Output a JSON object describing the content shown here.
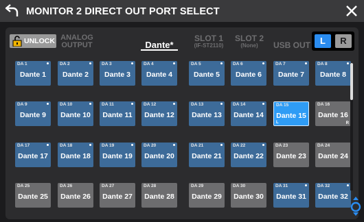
{
  "window": {
    "title": "MONITOR 2 DIRECT OUT PORT SELECT"
  },
  "toolbar": {
    "unlock_label": "UNLOCK",
    "tabs": [
      {
        "line1": "ANALOG",
        "line2": "OUTPUT"
      },
      {
        "line1": "Dante*",
        "line2": ""
      },
      {
        "line1": "SLOT 1",
        "line2": "(IF-ST2110)"
      },
      {
        "line1": "SLOT 2",
        "line2": "(None)"
      },
      {
        "line1": "USB OUT",
        "line2": ""
      }
    ],
    "active_tab": "Dante*",
    "channel_l": "L",
    "channel_r": "R"
  },
  "ports": [
    {
      "da": "DA 1",
      "name": "Dante 1",
      "state": "blue",
      "dot": true
    },
    {
      "da": "DA 2",
      "name": "Dante 2",
      "state": "blue",
      "dot": true
    },
    {
      "da": "DA 3",
      "name": "Dante 3",
      "state": "blue",
      "dot": true
    },
    {
      "da": "DA 4",
      "name": "Dante 4",
      "state": "blue",
      "dot": true
    },
    {
      "da": "DA 5",
      "name": "Dante 5",
      "state": "blue",
      "dot": true
    },
    {
      "da": "DA 6",
      "name": "Dante 6",
      "state": "blue",
      "dot": true
    },
    {
      "da": "DA 7",
      "name": "Dante 7",
      "state": "blue",
      "dot": true
    },
    {
      "da": "DA 8",
      "name": "Dante 8",
      "state": "blue",
      "dot": true
    },
    {
      "da": "DA 9",
      "name": "Dante 9",
      "state": "blue",
      "dot": true
    },
    {
      "da": "DA 10",
      "name": "Dante 10",
      "state": "blue",
      "dot": true
    },
    {
      "da": "DA 11",
      "name": "Dante 11",
      "state": "blue",
      "dot": true
    },
    {
      "da": "DA 12",
      "name": "Dante 12",
      "state": "blue",
      "dot": true
    },
    {
      "da": "DA 13",
      "name": "Dante 13",
      "state": "blue",
      "dot": true
    },
    {
      "da": "DA 14",
      "name": "Dante 14",
      "state": "blue",
      "dot": true
    },
    {
      "da": "DA 15",
      "name": "Dante 15",
      "state": "selected",
      "dot": false,
      "mark": "L"
    },
    {
      "da": "DA 16",
      "name": "Dante 16",
      "state": "gray",
      "dot": false,
      "mark": "R"
    },
    {
      "da": "DA 17",
      "name": "Dante 17",
      "state": "blue",
      "dot": true
    },
    {
      "da": "DA 18",
      "name": "Dante 18",
      "state": "blue",
      "dot": true
    },
    {
      "da": "DA 19",
      "name": "Dante 19",
      "state": "blue",
      "dot": true
    },
    {
      "da": "DA 20",
      "name": "Dante 20",
      "state": "blue",
      "dot": true
    },
    {
      "da": "DA 21",
      "name": "Dante 21",
      "state": "blue",
      "dot": true
    },
    {
      "da": "DA 22",
      "name": "Dante 22",
      "state": "blue",
      "dot": true
    },
    {
      "da": "DA 23",
      "name": "Dante 23",
      "state": "gray",
      "dot": false
    },
    {
      "da": "DA 24",
      "name": "Dante 24",
      "state": "gray",
      "dot": false
    },
    {
      "da": "DA 25",
      "name": "Dante 25",
      "state": "gray",
      "dot": false
    },
    {
      "da": "DA 26",
      "name": "Dante 26",
      "state": "gray",
      "dot": false
    },
    {
      "da": "DA 27",
      "name": "Dante 27",
      "state": "gray",
      "dot": false
    },
    {
      "da": "DA 28",
      "name": "Dante 28",
      "state": "gray",
      "dot": false
    },
    {
      "da": "DA 29",
      "name": "Dante 29",
      "state": "gray",
      "dot": false
    },
    {
      "da": "DA 30",
      "name": "Dante 30",
      "state": "gray",
      "dot": false
    },
    {
      "da": "DA 31",
      "name": "Dante 31",
      "state": "blue",
      "dot": true
    },
    {
      "da": "DA 32",
      "name": "Dante 32",
      "state": "blue",
      "dot": true
    }
  ],
  "scroll": {
    "position": 0.0
  },
  "colors": {
    "accent": "#2a8cf0",
    "assigned": "#3d6b99",
    "unassigned": "#6d6d6f",
    "selected": "#2f9cf5"
  },
  "icons": {
    "back": "back-arrow-icon",
    "close": "close-icon",
    "lock": "unlock-padlock-icon",
    "knob": "encoder-knob-icon"
  }
}
